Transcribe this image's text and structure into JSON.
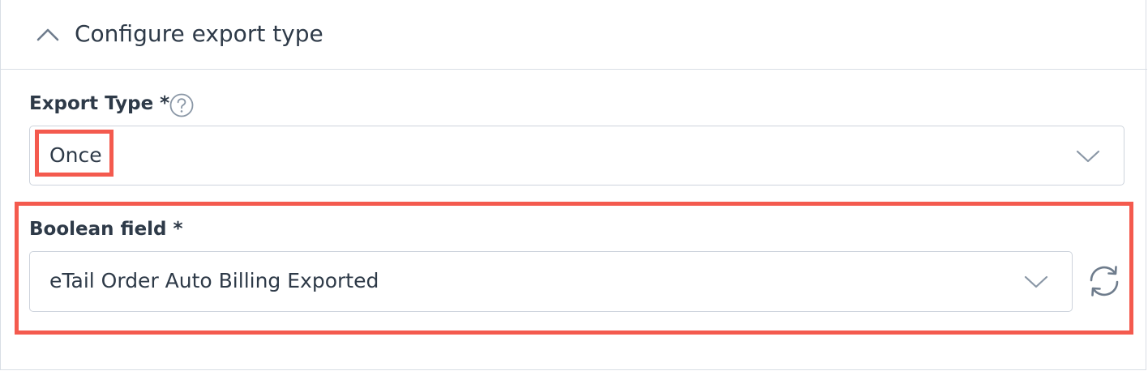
{
  "panel": {
    "title": "Configure export type",
    "collapse_icon": "chevron-up-icon"
  },
  "export_type": {
    "label": "Export Type *",
    "help_icon": "question-circle-icon",
    "value": "Once",
    "chevron_icon": "chevron-down-icon"
  },
  "boolean_field": {
    "label": "Boolean field *",
    "value": "eTail Order Auto Billing Exported",
    "chevron_icon": "chevron-down-icon",
    "refresh_icon": "refresh-icon"
  },
  "colors": {
    "text": "#2e3a48",
    "border": "#d9dee5",
    "input_border": "#cdd3dc",
    "icon": "#6e7c8c",
    "highlight": "#f45a4e"
  }
}
